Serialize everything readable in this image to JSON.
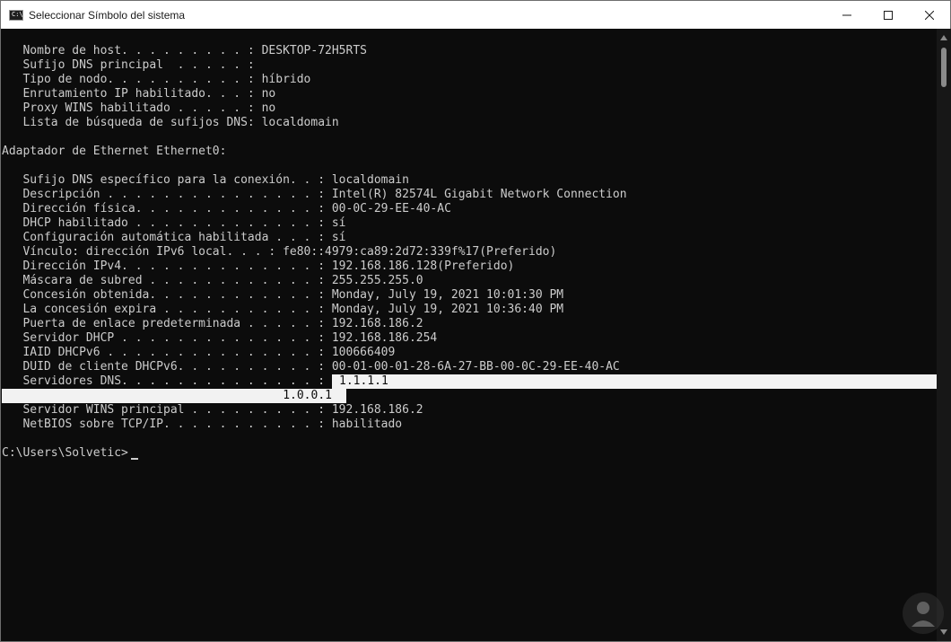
{
  "window": {
    "title": "Seleccionar Símbolo del sistema",
    "app_icon_text": "C:\\",
    "controls": [
      "minimize-icon",
      "maximize-icon",
      "close-icon"
    ]
  },
  "console": {
    "lines": [
      "   Nombre de host. . . . . . . . . : DESKTOP-72H5RTS",
      "   Sufijo DNS principal  . . . . . :",
      "   Tipo de nodo. . . . . . . . . . : híbrido",
      "   Enrutamiento IP habilitado. . . : no",
      "   Proxy WINS habilitado . . . . . : no",
      "   Lista de búsqueda de sufijos DNS: localdomain",
      "",
      "Adaptador de Ethernet Ethernet0:",
      "",
      "   Sufijo DNS específico para la conexión. . : localdomain",
      "   Descripción . . . . . . . . . . . . . . . : Intel(R) 82574L Gigabit Network Connection",
      "   Dirección física. . . . . . . . . . . . . : 00-0C-29-EE-40-AC",
      "   DHCP habilitado . . . . . . . . . . . . . : sí",
      "   Configuración automática habilitada . . . : sí",
      "   Vínculo: dirección IPv6 local. . . : fe80::4979:ca89:2d72:339f%17(Preferido)",
      "   Dirección IPv4. . . . . . . . . . . . . . : 192.168.186.128(Preferido)",
      "   Máscara de subred . . . . . . . . . . . . : 255.255.255.0",
      "   Concesión obtenida. . . . . . . . . . . . : Monday, July 19, 2021 10:01:30 PM",
      "   La concesión expira . . . . . . . . . . . : Monday, July 19, 2021 10:36:40 PM",
      "   Puerta de enlace predeterminada . . . . . : 192.168.186.2",
      "   Servidor DHCP . . . . . . . . . . . . . . : 192.168.186.254",
      "   IAID DHCPv6 . . . . . . . . . . . . . . . : 100666409",
      "   DUID de cliente DHCPv6. . . . . . . . . . : 00-01-00-01-28-6A-27-BB-00-0C-29-EE-40-AC",
      "   Servidores DNS. . . . . . . . . . . . . . :",
      "",
      "   Servidor WINS principal . . . . . . . . . : 192.168.186.2",
      "   NetBIOS sobre TCP/IP. . . . . . . . . . . : habilitado",
      "",
      "C:\\Users\\Solvetic>"
    ],
    "selection": {
      "dns_primary": "1.1.1.1",
      "dns_secondary": "1.0.0.1"
    }
  },
  "colors": {
    "console_bg": "#0c0c0c",
    "console_text": "#cccccc",
    "selection_bg": "#f2f2f2",
    "titlebar_bg": "#ffffff"
  }
}
